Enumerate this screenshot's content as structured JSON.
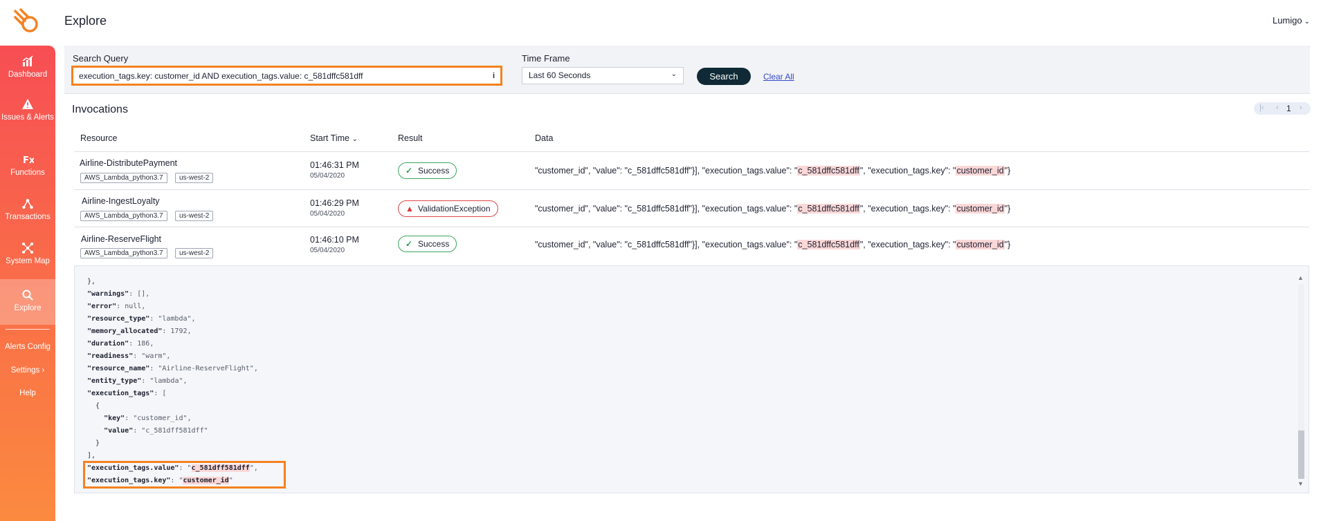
{
  "header": {
    "title": "Explore",
    "user": "Lumigo"
  },
  "sidebar": {
    "items": [
      {
        "label": "Dashboard",
        "icon": "bar-chart-icon"
      },
      {
        "label": "Issues & Alerts",
        "icon": "warning-icon"
      },
      {
        "label": "Functions",
        "icon": "fx-icon"
      },
      {
        "label": "Transactions",
        "icon": "transactions-icon"
      },
      {
        "label": "System Map",
        "icon": "system-map-icon"
      },
      {
        "label": "Explore",
        "icon": "search-icon",
        "active": true
      }
    ],
    "links": [
      "Alerts Config",
      "Settings",
      "Help"
    ]
  },
  "search": {
    "query_label": "Search Query",
    "query_value": "execution_tags.key: customer_id AND execution_tags.value: c_581dffc581dff",
    "info": "i",
    "timeframe_label": "Time Frame",
    "timeframe_value": "Last 60 Seconds",
    "search_button": "Search",
    "clear_all": "Clear All"
  },
  "invocations": {
    "title": "Invocations",
    "page": "1",
    "columns": {
      "resource": "Resource",
      "start_time": "Start Time",
      "result": "Result",
      "data": "Data"
    },
    "rows": [
      {
        "resource": "Airline-DistributePayment",
        "tags": [
          "AWS_Lambda_python3.7",
          "us-west-2"
        ],
        "time": "01:46:31 PM",
        "date": "05/04/2020",
        "result": "Success",
        "data_prefix": "\"customer_id\", \"value\": \"c_581dffc581dff\"}], \"execution_tags.value\": \"",
        "data_hl1": "c_581dffc581dff",
        "data_mid": "\", \"execution_tags.key\": \"",
        "data_hl2": "customer_id",
        "data_suffix": "\"}"
      },
      {
        "resource": "Airline-IngestLoyalty",
        "tags": [
          "AWS_Lambda_python3.7",
          "us-west-2"
        ],
        "time": "01:46:29 PM",
        "date": "05/04/2020",
        "result": "ValidationException",
        "data_prefix": "\"customer_id\", \"value\": \"c_581dffc581dff\"}], \"execution_tags.value\": \"",
        "data_hl1": "c_581dffc581dff",
        "data_mid": "\", \"execution_tags.key\": \"",
        "data_hl2": "customer_id",
        "data_suffix": "\"}"
      },
      {
        "resource": "Airline-ReserveFlight",
        "tags": [
          "AWS_Lambda_python3.7",
          "us-west-2"
        ],
        "time": "01:46:10 PM",
        "date": "05/04/2020",
        "result": "Success",
        "data_prefix": "\"customer_id\", \"value\": \"c_581dffc581dff\"}], \"execution_tags.value\": \"",
        "data_hl1": "c_581dffc581dff",
        "data_mid": "\", \"execution_tags.key\": \"",
        "data_hl2": "customer_id",
        "data_suffix": "\"}"
      }
    ]
  },
  "json_detail": {
    "l0": "},",
    "l1k": "\"warnings\"",
    "l1v": ": [],",
    "l2k": "\"error\"",
    "l2v": ": null,",
    "l3k": "\"resource_type\"",
    "l3v": ": \"lambda\",",
    "l4k": "\"memory_allocated\"",
    "l4v": ": 1792,",
    "l5k": "\"duration\"",
    "l5v": ": 186,",
    "l6k": "\"readiness\"",
    "l6v": ": \"warm\",",
    "l7k": "\"resource_name\"",
    "l7v": ": \"Airline-ReserveFlight\",",
    "l8k": "\"entity_type\"",
    "l8v": ": \"lambda\",",
    "l9k": "\"execution_tags\"",
    "l9v": ": [",
    "l10": "  {",
    "l11k": "    \"key\"",
    "l11v": ": \"customer_id\",",
    "l12k": "    \"value\"",
    "l12v": ": \"c_581dff581dff\"",
    "l13": "  }",
    "l14": "],",
    "l15k": "\"execution_tags.value\"",
    "l15a": ": \"",
    "l15h": "c_581dff581dff",
    "l15b": "\",",
    "l16k": "\"execution_tags.key\"",
    "l16a": ": \"",
    "l16h": "customer_id",
    "l16b": "\""
  },
  "colors": {
    "accent_orange": "#f5811f",
    "sidebar_top": "#f74e54",
    "sidebar_bottom": "#fb8a3f",
    "search_button": "#0f2a36",
    "success": "#3aa55b",
    "error": "#e04444",
    "highlight": "#fbd7d7"
  }
}
